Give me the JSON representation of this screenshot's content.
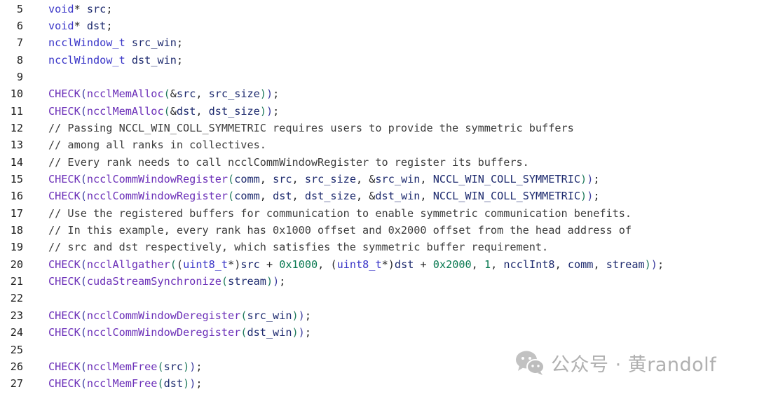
{
  "code_view": {
    "lines": [
      {
        "number": "5",
        "tokens": [
          [
            "kw",
            "void"
          ],
          [
            "pn",
            "* "
          ],
          [
            "id",
            "src"
          ],
          [
            "pn",
            ";"
          ]
        ]
      },
      {
        "number": "6",
        "tokens": [
          [
            "kw",
            "void"
          ],
          [
            "pn",
            "* "
          ],
          [
            "id",
            "dst"
          ],
          [
            "pn",
            ";"
          ]
        ]
      },
      {
        "number": "7",
        "tokens": [
          [
            "kw",
            "ncclWindow_t"
          ],
          [
            "pn",
            " "
          ],
          [
            "id",
            "src_win"
          ],
          [
            "pn",
            ";"
          ]
        ]
      },
      {
        "number": "8",
        "tokens": [
          [
            "kw",
            "ncclWindow_t"
          ],
          [
            "pn",
            " "
          ],
          [
            "id",
            "dst_win"
          ],
          [
            "pn",
            ";"
          ]
        ]
      },
      {
        "number": "9",
        "tokens": []
      },
      {
        "number": "10",
        "tokens": [
          [
            "fn",
            "CHECK"
          ],
          [
            "p1",
            "("
          ],
          [
            "fn",
            "ncclMemAlloc"
          ],
          [
            "p2",
            "("
          ],
          [
            "pn",
            "&"
          ],
          [
            "id",
            "src"
          ],
          [
            "pn",
            ", "
          ],
          [
            "id",
            "src_size"
          ],
          [
            "p2",
            ")"
          ],
          [
            "p1",
            ")"
          ],
          [
            "pn",
            ";"
          ]
        ]
      },
      {
        "number": "11",
        "tokens": [
          [
            "fn",
            "CHECK"
          ],
          [
            "p1",
            "("
          ],
          [
            "fn",
            "ncclMemAlloc"
          ],
          [
            "p2",
            "("
          ],
          [
            "pn",
            "&"
          ],
          [
            "id",
            "dst"
          ],
          [
            "pn",
            ", "
          ],
          [
            "id",
            "dst_size"
          ],
          [
            "p2",
            ")"
          ],
          [
            "p1",
            ")"
          ],
          [
            "pn",
            ";"
          ]
        ]
      },
      {
        "number": "12",
        "tokens": [
          [
            "cmt",
            "// Passing NCCL_WIN_COLL_SYMMETRIC requires users to provide the symmetric buffers"
          ]
        ]
      },
      {
        "number": "13",
        "tokens": [
          [
            "cmt",
            "// among all ranks in collectives."
          ]
        ]
      },
      {
        "number": "14",
        "tokens": [
          [
            "cmt",
            "// Every rank needs to call ncclCommWindowRegister to register its buffers."
          ]
        ]
      },
      {
        "number": "15",
        "tokens": [
          [
            "fn",
            "CHECK"
          ],
          [
            "p1",
            "("
          ],
          [
            "fn",
            "ncclCommWindowRegister"
          ],
          [
            "p2",
            "("
          ],
          [
            "id",
            "comm"
          ],
          [
            "pn",
            ", "
          ],
          [
            "id",
            "src"
          ],
          [
            "pn",
            ", "
          ],
          [
            "id",
            "src_size"
          ],
          [
            "pn",
            ", &"
          ],
          [
            "id",
            "src_win"
          ],
          [
            "pn",
            ", "
          ],
          [
            "cst",
            "NCCL_WIN_COLL_SYMMETRIC"
          ],
          [
            "p2",
            ")"
          ],
          [
            "p1",
            ")"
          ],
          [
            "pn",
            ";"
          ]
        ]
      },
      {
        "number": "16",
        "tokens": [
          [
            "fn",
            "CHECK"
          ],
          [
            "p1",
            "("
          ],
          [
            "fn",
            "ncclCommWindowRegister"
          ],
          [
            "p2",
            "("
          ],
          [
            "id",
            "comm"
          ],
          [
            "pn",
            ", "
          ],
          [
            "id",
            "dst"
          ],
          [
            "pn",
            ", "
          ],
          [
            "id",
            "dst_size"
          ],
          [
            "pn",
            ", &"
          ],
          [
            "id",
            "dst_win"
          ],
          [
            "pn",
            ", "
          ],
          [
            "cst",
            "NCCL_WIN_COLL_SYMMETRIC"
          ],
          [
            "p2",
            ")"
          ],
          [
            "p1",
            ")"
          ],
          [
            "pn",
            ";"
          ]
        ]
      },
      {
        "number": "17",
        "tokens": [
          [
            "cmt",
            "// Use the registered buffers for communication to enable symmetric communication benefits."
          ]
        ]
      },
      {
        "number": "18",
        "tokens": [
          [
            "cmt",
            "// In this example, every rank has 0x1000 offset and 0x2000 offset from the head address of"
          ]
        ]
      },
      {
        "number": "19",
        "tokens": [
          [
            "cmt",
            "// src and dst respectively, which satisfies the symmetric buffer requirement."
          ]
        ]
      },
      {
        "number": "20",
        "tokens": [
          [
            "fn",
            "CHECK"
          ],
          [
            "p1",
            "("
          ],
          [
            "fn",
            "ncclAllgather"
          ],
          [
            "p2",
            "("
          ],
          [
            "p3",
            "("
          ],
          [
            "kw",
            "uint8_t"
          ],
          [
            "pn",
            "*"
          ],
          [
            "p3",
            ")"
          ],
          [
            "id",
            "src"
          ],
          [
            "pn",
            " + "
          ],
          [
            "num",
            "0x1000"
          ],
          [
            "pn",
            ", "
          ],
          [
            "p3",
            "("
          ],
          [
            "kw",
            "uint8_t"
          ],
          [
            "pn",
            "*"
          ],
          [
            "p3",
            ")"
          ],
          [
            "id",
            "dst"
          ],
          [
            "pn",
            " + "
          ],
          [
            "num",
            "0x2000"
          ],
          [
            "pn",
            ", "
          ],
          [
            "num",
            "1"
          ],
          [
            "pn",
            ", "
          ],
          [
            "id",
            "ncclInt8"
          ],
          [
            "pn",
            ", "
          ],
          [
            "id",
            "comm"
          ],
          [
            "pn",
            ", "
          ],
          [
            "id",
            "stream"
          ],
          [
            "p2",
            ")"
          ],
          [
            "p1",
            ")"
          ],
          [
            "pn",
            ";"
          ]
        ]
      },
      {
        "number": "21",
        "tokens": [
          [
            "fn",
            "CHECK"
          ],
          [
            "p1",
            "("
          ],
          [
            "fn",
            "cudaStreamSynchronize"
          ],
          [
            "p2",
            "("
          ],
          [
            "id",
            "stream"
          ],
          [
            "p2",
            ")"
          ],
          [
            "p1",
            ")"
          ],
          [
            "pn",
            ";"
          ]
        ]
      },
      {
        "number": "22",
        "tokens": []
      },
      {
        "number": "23",
        "tokens": [
          [
            "fn",
            "CHECK"
          ],
          [
            "p1",
            "("
          ],
          [
            "fn",
            "ncclCommWindowDeregister"
          ],
          [
            "p2",
            "("
          ],
          [
            "id",
            "src_win"
          ],
          [
            "p2",
            ")"
          ],
          [
            "p1",
            ")"
          ],
          [
            "pn",
            ";"
          ]
        ]
      },
      {
        "number": "24",
        "tokens": [
          [
            "fn",
            "CHECK"
          ],
          [
            "p1",
            "("
          ],
          [
            "fn",
            "ncclCommWindowDeregister"
          ],
          [
            "p2",
            "("
          ],
          [
            "id",
            "dst_win"
          ],
          [
            "p2",
            ")"
          ],
          [
            "p1",
            ")"
          ],
          [
            "pn",
            ";"
          ]
        ]
      },
      {
        "number": "25",
        "tokens": []
      },
      {
        "number": "26",
        "tokens": [
          [
            "fn",
            "CHECK"
          ],
          [
            "p1",
            "("
          ],
          [
            "fn",
            "ncclMemFree"
          ],
          [
            "p2",
            "("
          ],
          [
            "id",
            "src"
          ],
          [
            "p2",
            ")"
          ],
          [
            "p1",
            ")"
          ],
          [
            "pn",
            ";"
          ]
        ]
      },
      {
        "number": "27",
        "tokens": [
          [
            "fn",
            "CHECK"
          ],
          [
            "p1",
            "("
          ],
          [
            "fn",
            "ncclMemFree"
          ],
          [
            "p2",
            "("
          ],
          [
            "id",
            "dst"
          ],
          [
            "p2",
            ")"
          ],
          [
            "p1",
            ")"
          ],
          [
            "pn",
            ";"
          ]
        ]
      }
    ]
  },
  "watermark": {
    "text": "公众号 · 黄randolf",
    "icon": "wechat-icon"
  },
  "colors": {
    "keyword": "#3a36c8",
    "function": "#6b2fb8",
    "identifier": "#1d2a6e",
    "number": "#0a7a52",
    "comment": "#3d3d3d",
    "watermark": "#b0b0b0"
  }
}
